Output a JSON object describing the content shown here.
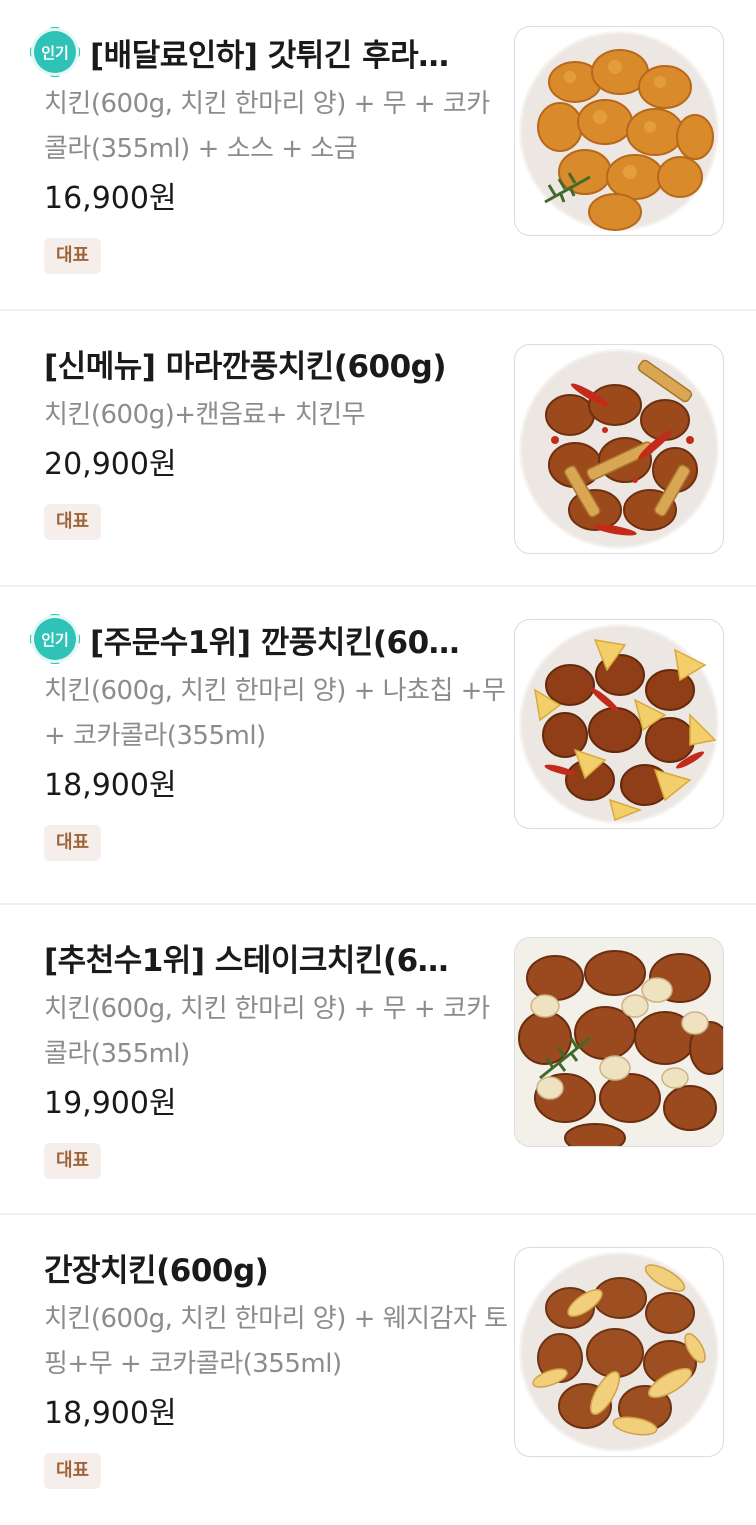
{
  "menu": {
    "items": [
      {
        "badge": "인기",
        "title": "[배달료인하] 갓튀긴 후라…",
        "desc": "치킨(600g, 치킨 한마리 양) + 무 + 코카콜라(355ml) +  소스 + 소금",
        "price": "16,900원",
        "tag": "대표",
        "image": "fried-chicken-photo"
      },
      {
        "title": "[신메뉴] 마라깐풍치킨(600g)",
        "desc": "치킨(600g)+캔음료+ 치킨무",
        "price": "20,900원",
        "tag": "대표",
        "image": "mala-kkanpung-chicken-photo"
      },
      {
        "badge": "인기",
        "title": "[주문수1위] 깐풍치킨(60…",
        "desc": "치킨(600g, 치킨 한마리 양) + 나쵸칩 +무 + 코카콜라(355ml)",
        "price": "18,900원",
        "tag": "대표",
        "image": "kkanpung-chicken-photo"
      },
      {
        "title": "[추천수1위] 스테이크치킨(6…",
        "desc": "치킨(600g, 치킨 한마리 양) + 무 + 코카콜라(355ml)",
        "price": "19,900원",
        "tag": "대표",
        "image": "steak-chicken-photo"
      },
      {
        "title": "간장치킨(600g)",
        "desc": "치킨(600g, 치킨 한마리 양) + 웨지감자 토핑+무 + 코카콜라(355ml)",
        "price": "18,900원",
        "tag": "대표",
        "image": "soy-chicken-photo"
      }
    ]
  }
}
